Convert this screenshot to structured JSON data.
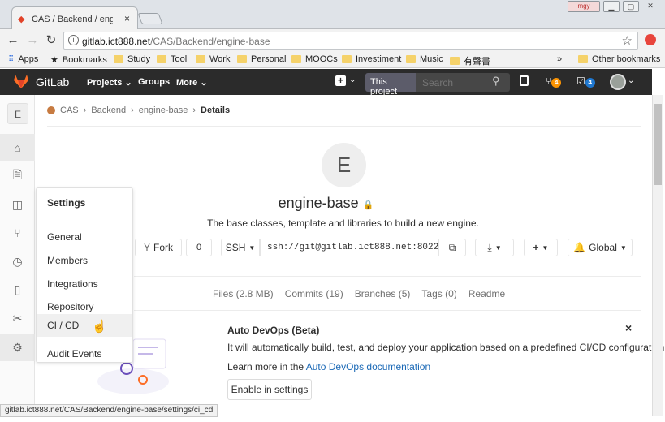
{
  "browser": {
    "tab_title": "CAS / Backend / engine-",
    "profile_badge": "mgy",
    "url_host": "gitlab.ict888.net",
    "url_path": "/CAS/Backend/engine-base",
    "bookmarks": [
      "Apps",
      "Bookmarks",
      "Study",
      "Tool",
      "Work",
      "Personal",
      "MOOCs",
      "Investiment",
      "Music",
      "有聲書"
    ],
    "more_bookmarks": "»",
    "other_bookmarks": "Other bookmarks",
    "status_url": "gitlab.ict888.net/CAS/Backend/engine-base/settings/ci_cd"
  },
  "header": {
    "logo": "GitLab",
    "projects": "Projects",
    "groups": "Groups",
    "more": "More",
    "search_scope": "This project",
    "search_placeholder": "Search",
    "mr_count": "4",
    "todo_count": "4"
  },
  "sidebar": {
    "project_letter": "E",
    "collapse": "»"
  },
  "breadcrumb": {
    "items": [
      "CAS",
      "Backend",
      "engine-base"
    ],
    "current": "Details"
  },
  "project": {
    "avatar_letter": "E",
    "name": "engine-base",
    "description": "The base classes, template and libraries to build a new engine.",
    "fork_label": "Fork",
    "fork_count": "0",
    "clone_protocol": "SSH",
    "clone_url": "ssh://git@gitlab.ict888.net:8022/",
    "notification": "Global"
  },
  "stats": {
    "files": "Files (2.8 MB)",
    "commits": "Commits (19)",
    "branches": "Branches (5)",
    "tags": "Tags (0)",
    "readme": "Readme"
  },
  "devops": {
    "title": "Auto DevOps (Beta)",
    "text": "It will automatically build, test, and deploy your application based on a predefined CI/CD configuration.",
    "learn_prefix": "Learn more in the ",
    "learn_link": "Auto DevOps documentation",
    "enable_button": "Enable in settings",
    "close": "×"
  },
  "flyout": {
    "title": "Settings",
    "items": [
      "General",
      "Members",
      "Integrations",
      "Repository",
      "CI / CD",
      "Audit Events"
    ]
  },
  "colors": {
    "header_bg": "#2b2b2b",
    "badge_orange": "#fc9403",
    "badge_blue": "#1f78d1",
    "link": "#1b69b6"
  }
}
